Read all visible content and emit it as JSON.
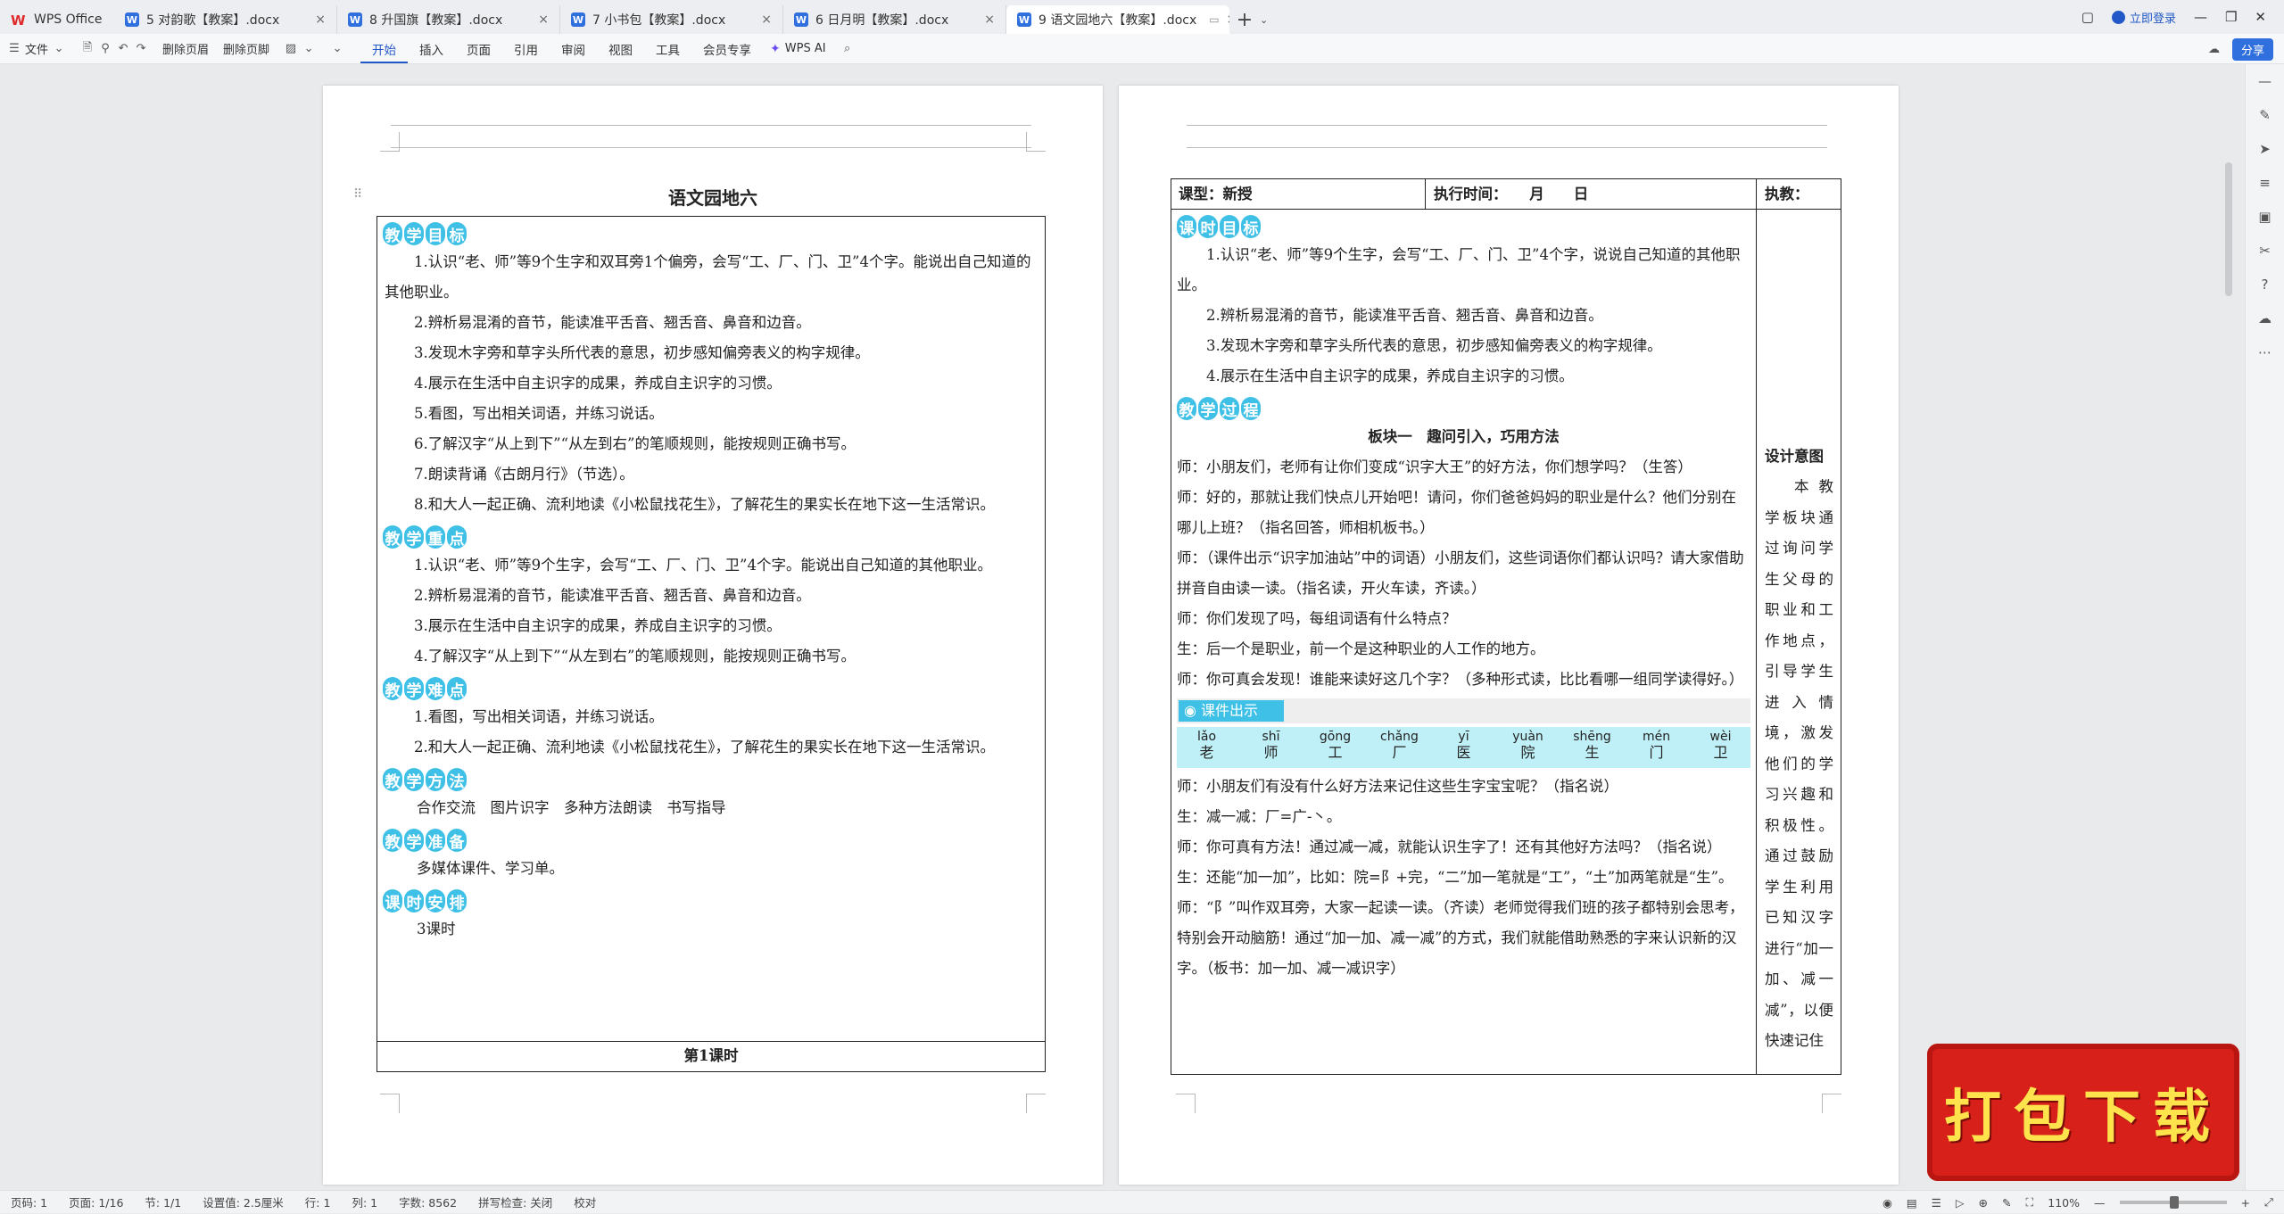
{
  "tabs": [
    {
      "label": "WPS Office",
      "type": "home"
    },
    {
      "label": "5 对韵歌【教案】.docx"
    },
    {
      "label": "8 升国旗【教案】.docx"
    },
    {
      "label": "7 小书包【教案】.docx"
    },
    {
      "label": "6 日月明【教案】.docx"
    },
    {
      "label": "9 语文园地六【教案】.docx",
      "active": true
    }
  ],
  "window": {
    "login_label": "立即登录",
    "share_label": "分享"
  },
  "toolbar": {
    "file_label": "文件",
    "delete_header_label": "删除页眉",
    "delete_footer_label": "删除页脚",
    "menus": [
      "开始",
      "插入",
      "页面",
      "引用",
      "审阅",
      "视图",
      "工具",
      "会员专享"
    ],
    "active_menu": "开始",
    "wps_ai_label": "WPS AI"
  },
  "left_page": {
    "title": "语文园地六",
    "sections": [
      {
        "heading": [
          "教",
          "学",
          "目",
          "标"
        ],
        "paras": [
          "1.认识“老、师”等9个生字和双耳旁1个偏旁，会写“工、厂、门、卫”4个字。能说出自己知道的其他职业。",
          "2.辨析易混淆的音节，能读准平舌音、翘舌音、鼻音和边音。",
          "3.发现木字旁和草字头所代表的意思，初步感知偏旁表义的构字规律。",
          "4.展示在生活中自主识字的成果，养成自主识字的习惯。",
          "5.看图，写出相关词语，并练习说话。",
          "6.了解汉字“从上到下”“从左到右”的笔顺规则，能按规则正确书写。",
          "7.朗读背诵《古朗月行》（节选）。",
          "8.和大人一起正确、流利地读《小松鼠找花生》，了解花生的果实长在地下这一生活常识。"
        ]
      },
      {
        "heading": [
          "教",
          "学",
          "重",
          "点"
        ],
        "paras": [
          "1.认识“老、师”等9个生字，会写“工、厂、门、卫”4个字。能说出自己知道的其他职业。",
          "2.辨析易混淆的音节，能读准平舌音、翘舌音、鼻音和边音。",
          "3.展示在生活中自主识字的成果，养成自主识字的习惯。",
          "4.了解汉字“从上到下”“从左到右”的笔顺规则，能按规则正确书写。"
        ]
      },
      {
        "heading": [
          "教",
          "学",
          "难",
          "点"
        ],
        "paras": [
          "1.看图，写出相关词语，并练习说话。",
          "2.和大人一起正确、流利地读《小松鼠找花生》，了解花生的果实长在地下这一生活常识。"
        ]
      },
      {
        "heading": [
          "教",
          "学",
          "方",
          "法"
        ],
        "paras": [
          "合作交流　图片识字　多种方法朗读　书写指导"
        ]
      },
      {
        "heading": [
          "教",
          "学",
          "准",
          "备"
        ],
        "paras": [
          "多媒体课件、学习单。"
        ]
      },
      {
        "heading": [
          "课",
          "时",
          "安",
          "排"
        ],
        "paras": [
          "3课时"
        ]
      }
    ],
    "footer_row": "第1课时"
  },
  "right_page": {
    "header_cells": [
      "课型：新授",
      "执行时间：　　月　　日",
      "执教："
    ],
    "goal_heading": [
      "课",
      "时",
      "目",
      "标"
    ],
    "goals": [
      "1.认识“老、师”等9个生字，会写“工、厂、门、卫”4个字，说说自己知道的其他职业。",
      "2.辨析易混淆的音节，能读准平舌音、翘舌音、鼻音和边音。",
      "3.发现木字旁和草字头所代表的意思，初步感知偏旁表义的构字规律。",
      "4.展示在生活中自主识字的成果，养成自主识字的习惯。"
    ],
    "process_heading": [
      "教",
      "学",
      "过",
      "程"
    ],
    "block_title": "板块一　趣问引入，巧用方法",
    "dialogue_a": [
      "师：小朋友们，老师有让你们变成“识字大王”的好方法，你们想学吗？（生答）",
      "师：好的，那就让我们快点儿开始吧！请问，你们爸爸妈妈的职业是什么？他们分别在哪儿上班？（指名回答，师相机板书。）",
      "师：（课件出示“识字加油站”中的词语）小朋友们，这些词语你们都认识吗？请大家借助拼音自由读一读。（指名读，开火车读，齐读。）",
      "师：你们发现了吗，每组词语有什么特点？",
      "生：后一个是职业，前一个是这种职业的人工作的地方。",
      "师：你可真会发现！谁能来读好这几个字？（多种形式读，比比看哪一组同学读得好。）"
    ],
    "courseware_label": "课件出示",
    "pinyin_words": [
      {
        "py": "lǎo",
        "hz": "老"
      },
      {
        "py": "shī",
        "hz": "师"
      },
      {
        "py": "gōng",
        "hz": "工"
      },
      {
        "py": "chǎng",
        "hz": "厂"
      },
      {
        "py": "yī",
        "hz": "医"
      },
      {
        "py": "yuàn",
        "hz": "院"
      },
      {
        "py": "shēng",
        "hz": "生"
      },
      {
        "py": "mén",
        "hz": "门"
      },
      {
        "py": "wèi",
        "hz": "卫"
      }
    ],
    "dialogue_b": [
      "师：小朋友们有没有什么好方法来记住这些生字宝宝呢？（指名说）",
      "生：减一减：厂=广-丶。",
      "师：你可真有方法！通过减一减，就能认识生字了！还有其他好方法吗？（指名说）",
      "生：还能“加一加”，比如：院=阝+完，“二”加一笔就是“工”，“土”加两笔就是“生”。",
      "师：“阝”叫作双耳旁，大家一起读一读。（齐读）老师觉得我们班的孩子都特别会思考，特别会开动脑筋！通过“加一加、减一减”的方式，我们就能借助熟悉的字来认识新的汉字。（板书：加一加、减一减识字）"
    ],
    "side_title": "设计意图",
    "side_text": "本教学板块通过询问学生父母的职业和工作地点，引导学生进入情境，激发他们的学习兴趣和积极性。通过鼓励学生利用已知汉字进行“加一加、减一减”，以便快速记住"
  },
  "status": {
    "page_num": "页码: 1",
    "pages": "页面: 1/16",
    "section": "节: 1/1",
    "setting": "设置值: 2.5厘米",
    "row": "行: 1",
    "col": "列: 1",
    "word_count": "字数: 8562",
    "spellcheck": "拼写检查: 关闭",
    "proof": "校对",
    "zoom": "110%"
  },
  "promo_label": "打包下载",
  "colors": {
    "accent": "#2f6fde",
    "heading_pill": "#3fc0e6",
    "promo": "#d8201a"
  }
}
